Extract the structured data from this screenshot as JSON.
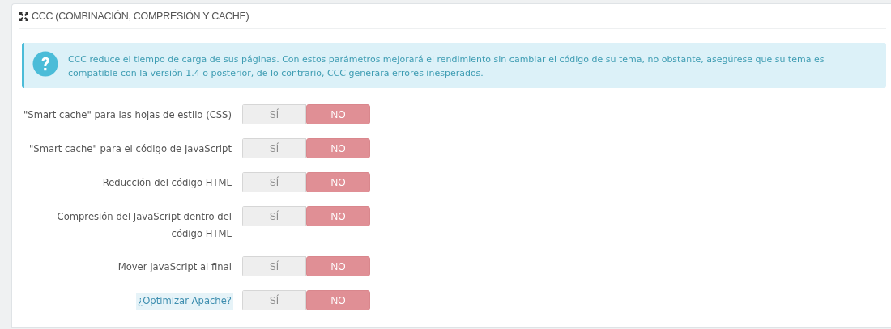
{
  "panel": {
    "title": "CCC (COMBINACIÓN, COMPRESIÓN Y CACHE)"
  },
  "alert": {
    "kind": "help",
    "text": "CCC reduce el tiempo de carga de sus páginas. Con estos parámetros mejorará el rendimiento sin cambiar el código de su tema, no obstante, asegúrese que su tema es compatible con la versión 1.4 o posterior, de lo contrario, CCC generara errores inesperados."
  },
  "settings": [
    {
      "label": "\"Smart cache\" para las hojas de estilo (CSS)",
      "kind": "plain",
      "options": [
        {
          "label": "SÍ",
          "selected": false
        },
        {
          "label": "NO",
          "selected": true
        }
      ]
    },
    {
      "label": "\"Smart cache\" para el código de JavaScript",
      "kind": "plain",
      "options": [
        {
          "label": "SÍ",
          "selected": false
        },
        {
          "label": "NO",
          "selected": true
        }
      ]
    },
    {
      "label": "Reducción del código HTML",
      "kind": "plain",
      "options": [
        {
          "label": "SÍ",
          "selected": false
        },
        {
          "label": "NO",
          "selected": true
        }
      ]
    },
    {
      "label": "Compresión del JavaScript dentro del código HTML",
      "kind": "plain",
      "options": [
        {
          "label": "SÍ",
          "selected": false
        },
        {
          "label": "NO",
          "selected": true
        }
      ]
    },
    {
      "label": "Mover JavaScript al final",
      "kind": "plain",
      "options": [
        {
          "label": "SÍ",
          "selected": false
        },
        {
          "label": "NO",
          "selected": true
        }
      ]
    },
    {
      "label": "¿Optimizar Apache?",
      "kind": "help",
      "options": [
        {
          "label": "SÍ",
          "selected": false
        },
        {
          "label": "NO",
          "selected": true
        }
      ]
    }
  ]
}
